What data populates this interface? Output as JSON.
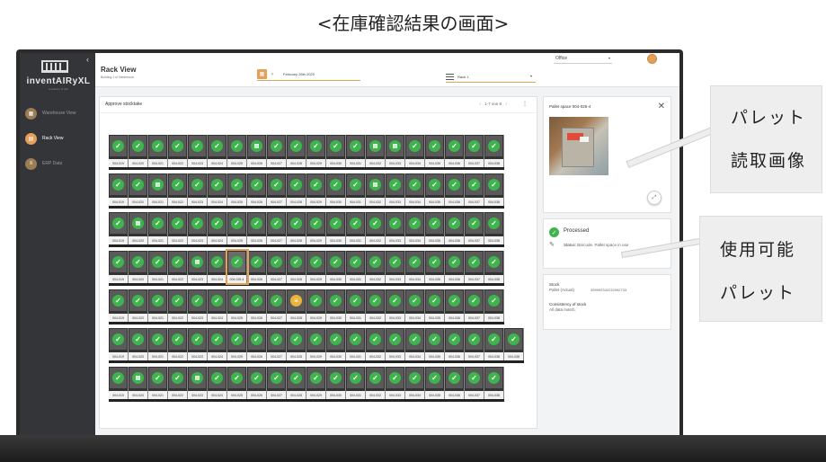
{
  "caption": "<在庫確認結果の画面>",
  "app": {
    "logo_text": "inventAIRyXL",
    "logo_sub": "a solution of dsb",
    "collapse": "‹"
  },
  "nav": {
    "items": [
      {
        "label": "Warehouse View",
        "icon": "warehouse-icon",
        "active": false
      },
      {
        "label": "Rack View",
        "icon": "rack-icon",
        "active": true
      },
      {
        "label": "ERP Data",
        "icon": "erp-icon",
        "active": false
      }
    ]
  },
  "topbar": {
    "title": "Rack View",
    "subtitle": "Building 1 in Niedersula",
    "date": "February 26th 2020",
    "rack": "Rack 1",
    "office": "Office"
  },
  "panel": {
    "title": "Approve stocktake",
    "pager": "1-7 von 8"
  },
  "rack": {
    "rows": [
      [
        "004-019",
        "004-020",
        "004-021",
        "004-022",
        "004-023",
        "004-024",
        "004-025",
        "004-026",
        "004-027",
        "004-028",
        "004-029",
        "004-030",
        "004-031",
        "004-032",
        "004-033",
        "004-034",
        "004-035",
        "004-036",
        "004-037",
        "004-038"
      ],
      [
        "004-019",
        "004-020",
        "004-021",
        "004-022",
        "004-023",
        "004-024",
        "004-025",
        "004-026",
        "004-027",
        "004-028",
        "004-029",
        "004-030",
        "004-031",
        "004-032",
        "004-033",
        "004-034",
        "004-035",
        "004-036",
        "004-037",
        "004-038"
      ],
      [
        "004-019",
        "004-020",
        "004-021",
        "004-022",
        "004-023",
        "004-024",
        "004-025",
        "004-026",
        "004-027",
        "004-028",
        "004-029",
        "004-030",
        "004-031",
        "004-032",
        "004-033",
        "004-034",
        "004-035",
        "004-036",
        "004-037",
        "004-038"
      ],
      [
        "004-019",
        "004-020",
        "004-021",
        "004-022",
        "004-023",
        "004-024",
        "004-025",
        "004-026",
        "004-027",
        "004-028",
        "004-029",
        "004-030",
        "004-031",
        "004-032",
        "004-033",
        "004-034",
        "004-035",
        "004-036",
        "004-037",
        "004-038"
      ],
      [
        "004-019",
        "004-020",
        "004-021",
        "004-022",
        "004-023",
        "004-024",
        "004-025",
        "004-026",
        "004-027",
        "004-028",
        "004-029",
        "004-030",
        "004-031",
        "004-032",
        "004-033",
        "004-034",
        "004-035",
        "004-036",
        "004-037",
        "004-038"
      ],
      [
        "004-019",
        "004-020",
        "004-021",
        "004-022",
        "004-023",
        "004-024",
        "004-025",
        "004-026",
        "004-027",
        "004-028",
        "004-029",
        "004-030",
        "004-031",
        "004-032",
        "004-033",
        "004-034",
        "004-035",
        "004-036",
        "004-037",
        "004-038"
      ],
      [
        "004-019",
        "004-020",
        "004-021",
        "004-022",
        "004-023",
        "004-024",
        "004-025",
        "004-026",
        "004-027",
        "004-028",
        "004-029",
        "004-030",
        "004-031",
        "004-032",
        "004-033",
        "004-034",
        "004-035",
        "004-036",
        "004-037",
        "004-038"
      ]
    ],
    "row_lengths": [
      20,
      20,
      20,
      20,
      20,
      21,
      20
    ],
    "special": {
      "0-7": "scan",
      "0-13": "scan",
      "0-14": "scan",
      "1-2": "scan",
      "1-13": "scan",
      "2-1": "scan",
      "3-4": "scan",
      "4-9": "warn",
      "6-1": "scan",
      "6-4": "scan"
    },
    "selected": {
      "row": 3,
      "col": 6,
      "label": "004-025-4"
    }
  },
  "detail": {
    "photo_title": "Pallet space 004-025-4",
    "status_title": "Processed",
    "status_label": "Status:",
    "status_value": "Barcode. Pallet space in use",
    "stock_label": "Stock",
    "stock_sub": "Pallet (Actual)",
    "stock_number": "399992342232092733",
    "consistency_label": "Consistency of stock",
    "consistency_value": "All data match."
  },
  "callouts": {
    "photo_line1": "パレット",
    "photo_line2": "読取画像",
    "status_line1": "使用可能",
    "status_line2": "パレット"
  },
  "colors": {
    "accent": "#e3a05a",
    "check": "#3fb44e",
    "warn": "#e8b43a",
    "sidebar": "#333538"
  }
}
